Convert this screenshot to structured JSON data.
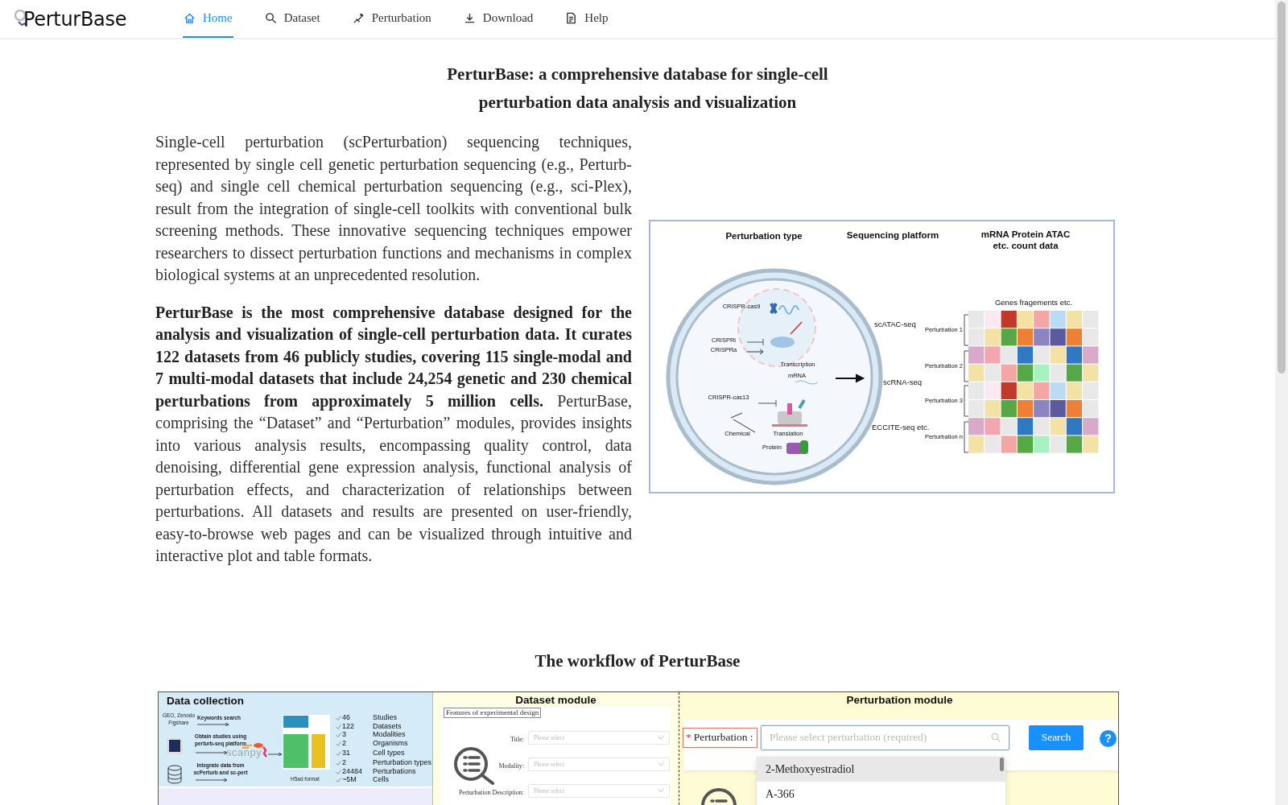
{
  "nav": {
    "logo": "PerturBase",
    "items": [
      {
        "label": "Home",
        "selected": true
      },
      {
        "label": "Dataset",
        "selected": false
      },
      {
        "label": "Perturbation",
        "selected": false
      },
      {
        "label": "Download",
        "selected": false
      },
      {
        "label": "Help",
        "selected": false
      }
    ]
  },
  "intro": {
    "title": "PerturBase: a comprehensive database for single-cell perturbation data analysis and visualization",
    "paragraphs": [
      "Single-cell perturbation (scPerturbation) sequencing techniques, represented by single cell genetic perturbation sequencing (e.g., Perturb-seq) and single cell chemical perturbation sequencing (e.g., sci-Plex), result from the integration of single-cell toolkits with conventional bulk screening methods. These innovative sequencing techniques empower researchers to dissect perturbation functions and mechanisms in complex biological systems at an unprecedented resolution.",
      "**PerturBase is the most comprehensive database designed for the analysis and visualization of single-cell perturbation data. It curates 122 datasets from 46 publicly studies, covering 115 single-modal and 7 multi-modal datasets that include 24,254 genetic and 230 chemical perturbations from approximately 5 million cells.** PerturBase, comprising the “Dataset” and “Perturbation” modules, provides insights into various analysis results, encompassing quality control, data denoising, differential gene expression analysis, functional analysis of perturbation effects, and characterization of relationships between perturbations. All datasets and results are presented on user-friendly, easy-to-browse web pages and can be visualized through intuitive and interactive plot and table formats."
    ]
  },
  "overview_figure": {
    "column_titles": [
      "Perturbation type",
      "Sequencing platform",
      "mRNA  Protein  ATAC",
      "etc. count data"
    ],
    "cell_labels": [
      "CRISPR-cas9",
      "CRISPRi",
      "CRISPRa",
      "Transcription",
      "mRNA",
      "CRISPR-cas13",
      "Chemical",
      "Translation",
      "Protein"
    ],
    "platforms": [
      "scATAC-seq",
      "scRNA-seq",
      "ECCITE-seq etc."
    ],
    "heatmap_header": "Genes  fragements etc.",
    "perturbations": [
      "Perturbation 1",
      "Perturbation 2",
      "Perturbation 3",
      "Perturbation n"
    ]
  },
  "workflow": {
    "title": "The workflow of PerturBase",
    "data_collection": {
      "title": "Data collection",
      "sources": [
        "GEO, Zenodo",
        "Figshare"
      ],
      "steps": [
        [
          "Keywords search"
        ],
        [
          "Obtain studies using",
          "perturb-seq platform"
        ],
        [
          "Integrate data from",
          "scPerturb and sc-pert"
        ]
      ],
      "tool": "scanpy",
      "format": "H5ad format",
      "stats": [
        {
          "value": "46",
          "label": "Studies"
        },
        {
          "value": "122",
          "label": "Datasets"
        },
        {
          "value": "3",
          "label": "Modalities"
        },
        {
          "value": "2",
          "label": "Organisms"
        },
        {
          "value": "31",
          "label": "Cell types"
        },
        {
          "value": "2",
          "label": "Perturbation types"
        },
        {
          "value": "24484",
          "label": "Perturbations"
        },
        {
          "value": "~5M",
          "label": "Cells"
        }
      ]
    },
    "dataset_module": {
      "title": "Dataset module",
      "section": "Features of experimental design",
      "fields": [
        {
          "label": "Title:",
          "placeholder": "Please select"
        },
        {
          "label": "Modality:",
          "placeholder": "Please select"
        },
        {
          "label": "Perturbation Description:",
          "placeholder": "Please select"
        }
      ]
    },
    "perturbation_module": {
      "title": "Perturbation module",
      "required_mark": "*",
      "label": "Perturbation :",
      "placeholder": "Please select perturbation (required)",
      "button": "Search",
      "help": "?",
      "options": [
        {
          "label": "2-Methoxyestradiol",
          "highlighted": true
        },
        {
          "label": "A-366",
          "highlighted": false
        }
      ]
    }
  }
}
